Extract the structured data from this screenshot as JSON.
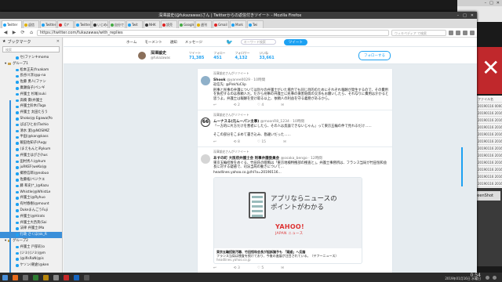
{
  "window": {
    "title": "深澤諭史(@fukazawas)さん | Twitterからの返信付きツイート - Mozilla Firefox",
    "tabs": [
      "Twitter",
      "返信",
      "Twitter",
      "【ア",
      "Twitter",
      "いじめの",
      "自分で",
      "Twit",
      "NHK",
      "読売",
      "Google",
      "週刊",
      "Gmail",
      "Mark",
      "Twi"
    ],
    "url": "https://twitter.com/fukazawas/with_replies",
    "search_placeholder": "ウィキペディア で検索"
  },
  "sidebar": {
    "title": "ブックマーク",
    "search_placeholder": "検索",
    "items": [
      {
        "label": "セ(ファンキmomo",
        "type": "bookmark"
      },
      {
        "label": "グループ1",
        "type": "folder"
      },
      {
        "label": "松本正夫(fruakam",
        "type": "bookmark"
      },
      {
        "label": "長谷川淳(@p-na",
        "type": "bookmark"
      },
      {
        "label": "佐藤 勇人(ファン",
        "type": "bookmark"
      },
      {
        "label": "廣瀬倫子(ペンギ",
        "type": "bookmark"
      },
      {
        "label": "弁護士 杉尾(suki",
        "type": "bookmark"
      },
      {
        "label": "高橋 壽(弁護士",
        "type": "bookmark"
      },
      {
        "label": "弁護士鈴木(Taga",
        "type": "bookmark"
      },
      {
        "label": "弁護士 太田たろう",
        "type": "bookmark"
      },
      {
        "label": "Shoko(@ Egawa(Po",
        "type": "bookmark"
      },
      {
        "label": "ばばひとお(Tashio",
        "type": "bookmark"
      },
      {
        "label": "清水 潔(@NOSIMZ",
        "type": "bookmark"
      },
      {
        "label": "半田(@kan@kass",
        "type": "bookmark"
      },
      {
        "label": "飯田佐知子(Augy",
        "type": "bookmark"
      },
      {
        "label": "(まえもんとiRykum",
        "type": "bookmark"
      },
      {
        "label": "弁護士はぴさ(hus",
        "type": "bookmark"
      },
      {
        "label": "田村秀人(@hum",
        "type": "bookmark"
      },
      {
        "label": "juRKEF(weKo(@",
        "type": "bookmark"
      },
      {
        "label": "郷原信郎(@nobuo",
        "type": "bookmark"
      },
      {
        "label": "佐藤拓(ベジクエ",
        "type": "bookmark"
      },
      {
        "label": "藤 和史(*_(@Kazu",
        "type": "bookmark"
      },
      {
        "label": "Whistle(@WhistLe",
        "type": "bookmark"
      },
      {
        "label": "弁護士(@Ryhuo",
        "type": "bookmark"
      },
      {
        "label": "有村春樹(@mount",
        "type": "bookmark"
      },
      {
        "label": "DukeまんごうFuji",
        "type": "bookmark"
      },
      {
        "label": "弁護士(@Hirats",
        "type": "bookmark"
      },
      {
        "label": "弁護士大西英(Sai",
        "type": "bookmark"
      },
      {
        "label": "法律 弁護士(Ma",
        "type": "bookmark"
      },
      {
        "label": "行政 さくほ(sk_R",
        "type": "bookmark"
      },
      {
        "label": "グループ2",
        "type": "folder"
      },
      {
        "label": "弁護士 戸部彩(o",
        "type": "bookmark"
      },
      {
        "label": "(ジミ)(ジミ(@m",
        "type": "bookmark"
      },
      {
        "label": "(@ifisRaN(@is",
        "type": "bookmark"
      },
      {
        "label": "ケソン(朝倉(@ken",
        "type": "bookmark"
      }
    ],
    "selected_index": 29
  },
  "twitter": {
    "nav": [
      "ホーム",
      "モーメント",
      "通知",
      "メッセージ"
    ],
    "search_placeholder": "キーワード検索",
    "tweet_button": "ツイート",
    "profile": {
      "name": "深澤諭史",
      "handle": "@fukazawas",
      "stats": [
        {
          "label": "ツイート",
          "value": "71,385"
        },
        {
          "label": "フォロー",
          "value": "451"
        },
        {
          "label": "フォロワー",
          "value": "4,132"
        },
        {
          "label": "いいね",
          "value": "33,661"
        }
      ],
      "follow_label": "フォローする"
    },
    "tweets": [
      {
        "context": "深澤諭史さんがリツイート",
        "name": "Shook",
        "handle": "@yanee0029 · 10時間",
        "reply_to": "返信先: @PinkYuClip",
        "body": "刑事と民事の弁護については別々の弁護士がいた場合でも同じ目的のためにそれぞれ報酬が発生するので、その費用を負担するのは依頼人だ。だから刑事の弁護士に民事の損害賠償の交渉もお願いしたら、それなりに費用はかかると思うよ。弁護士は報酬を受け取る以上、依頼人の利益を守る義務があるから。",
        "actions": [
          "↩",
          "⟲ 2",
          "♡ 4",
          "✉"
        ]
      },
      {
        "context": "深澤諭史さんがリツイート",
        "name": "ムーナスる(元ムーパン主事)",
        "handle": "@moonR8_1234 · 10時間",
        "reply_to": "",
        "body": "「一方的に片方だけを悪者にしたら、その人は反論できないじゃん」って東京五輪の件で見れるだけ……\n\nそこの部分をこまめて書き込み、勘違いだった……",
        "actions": [
          "↩",
          "⟲ 8",
          "♡ 15",
          "✉"
        ]
      },
      {
        "context": "深澤諭史さんがリツイート",
        "name": "あすの町 大阪府弁護士会 刑事弁護委員会",
        "handle": "@osaka_bengo · 12時間",
        "reply_to": "",
        "body": "東京五輪招致をめぐる、竹田氏の贈賄は「東京地検特捜部の捜査と」。弁護士事務所は、フランス当局が竹田恒和会長に対する疑惑で、司法当局の動きについて…",
        "link": "headlines.yahoo.co.jp/hl?a=20190116…",
        "card": {
          "title_line1": "アプリならニュースの",
          "title_line2": "ポイントがわかる",
          "logo": "YAHOO!",
          "logo_sub": "JAPAN ニュース",
          "headline": "東京五輪招致汚職、竹田恒和会長が起訴猶予も 「疑惑」へ反論",
          "desc": "フランス当局は捜査を続けており、今後の進展が注目されている。（ヤフーニュース）",
          "domain": "headlines.yahoo.co.jp"
        },
        "actions": [
          "↩",
          "⟲ 3",
          "♡ 5",
          "✉"
        ]
      }
    ]
  },
  "taskbar": {
    "time": "0:54",
    "date": "2019年01月16日 水曜日"
  },
  "background": {
    "screen_label": "screenShot",
    "list_items": [
      "ファイル名",
      "20190116 0000",
      "20190116 2016X",
      "20190116 2016X",
      "20190116 2016X",
      "20190116 2016X",
      "20190116 2016X",
      "20190116 2016X",
      "20190116 2016X",
      "20190116 2016X",
      "20190116 2016X",
      "20190116 2016X",
      "20190116 2016X"
    ]
  }
}
